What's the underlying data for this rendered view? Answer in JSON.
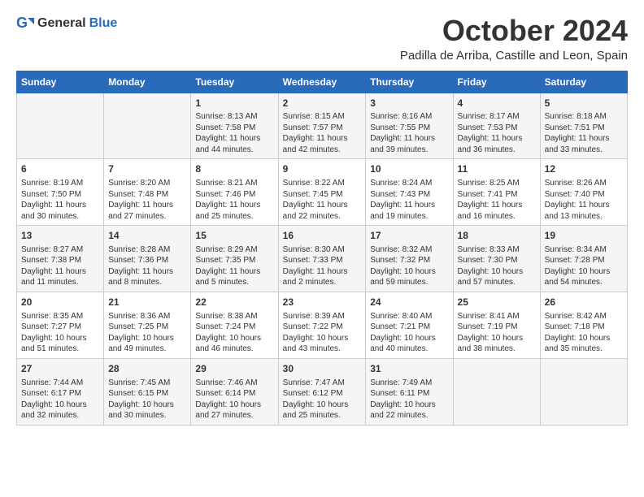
{
  "header": {
    "logo": {
      "text_general": "General",
      "text_blue": "Blue"
    },
    "title": "October 2024",
    "subtitle": "Padilla de Arriba, Castille and Leon, Spain"
  },
  "calendar": {
    "days_of_week": [
      "Sunday",
      "Monday",
      "Tuesday",
      "Wednesday",
      "Thursday",
      "Friday",
      "Saturday"
    ],
    "weeks": [
      [
        {
          "day": "",
          "info": ""
        },
        {
          "day": "",
          "info": ""
        },
        {
          "day": "1",
          "info": "Sunrise: 8:13 AM\nSunset: 7:58 PM\nDaylight: 11 hours and 44 minutes."
        },
        {
          "day": "2",
          "info": "Sunrise: 8:15 AM\nSunset: 7:57 PM\nDaylight: 11 hours and 42 minutes."
        },
        {
          "day": "3",
          "info": "Sunrise: 8:16 AM\nSunset: 7:55 PM\nDaylight: 11 hours and 39 minutes."
        },
        {
          "day": "4",
          "info": "Sunrise: 8:17 AM\nSunset: 7:53 PM\nDaylight: 11 hours and 36 minutes."
        },
        {
          "day": "5",
          "info": "Sunrise: 8:18 AM\nSunset: 7:51 PM\nDaylight: 11 hours and 33 minutes."
        }
      ],
      [
        {
          "day": "6",
          "info": "Sunrise: 8:19 AM\nSunset: 7:50 PM\nDaylight: 11 hours and 30 minutes."
        },
        {
          "day": "7",
          "info": "Sunrise: 8:20 AM\nSunset: 7:48 PM\nDaylight: 11 hours and 27 minutes."
        },
        {
          "day": "8",
          "info": "Sunrise: 8:21 AM\nSunset: 7:46 PM\nDaylight: 11 hours and 25 minutes."
        },
        {
          "day": "9",
          "info": "Sunrise: 8:22 AM\nSunset: 7:45 PM\nDaylight: 11 hours and 22 minutes."
        },
        {
          "day": "10",
          "info": "Sunrise: 8:24 AM\nSunset: 7:43 PM\nDaylight: 11 hours and 19 minutes."
        },
        {
          "day": "11",
          "info": "Sunrise: 8:25 AM\nSunset: 7:41 PM\nDaylight: 11 hours and 16 minutes."
        },
        {
          "day": "12",
          "info": "Sunrise: 8:26 AM\nSunset: 7:40 PM\nDaylight: 11 hours and 13 minutes."
        }
      ],
      [
        {
          "day": "13",
          "info": "Sunrise: 8:27 AM\nSunset: 7:38 PM\nDaylight: 11 hours and 11 minutes."
        },
        {
          "day": "14",
          "info": "Sunrise: 8:28 AM\nSunset: 7:36 PM\nDaylight: 11 hours and 8 minutes."
        },
        {
          "day": "15",
          "info": "Sunrise: 8:29 AM\nSunset: 7:35 PM\nDaylight: 11 hours and 5 minutes."
        },
        {
          "day": "16",
          "info": "Sunrise: 8:30 AM\nSunset: 7:33 PM\nDaylight: 11 hours and 2 minutes."
        },
        {
          "day": "17",
          "info": "Sunrise: 8:32 AM\nSunset: 7:32 PM\nDaylight: 10 hours and 59 minutes."
        },
        {
          "day": "18",
          "info": "Sunrise: 8:33 AM\nSunset: 7:30 PM\nDaylight: 10 hours and 57 minutes."
        },
        {
          "day": "19",
          "info": "Sunrise: 8:34 AM\nSunset: 7:28 PM\nDaylight: 10 hours and 54 minutes."
        }
      ],
      [
        {
          "day": "20",
          "info": "Sunrise: 8:35 AM\nSunset: 7:27 PM\nDaylight: 10 hours and 51 minutes."
        },
        {
          "day": "21",
          "info": "Sunrise: 8:36 AM\nSunset: 7:25 PM\nDaylight: 10 hours and 49 minutes."
        },
        {
          "day": "22",
          "info": "Sunrise: 8:38 AM\nSunset: 7:24 PM\nDaylight: 10 hours and 46 minutes."
        },
        {
          "day": "23",
          "info": "Sunrise: 8:39 AM\nSunset: 7:22 PM\nDaylight: 10 hours and 43 minutes."
        },
        {
          "day": "24",
          "info": "Sunrise: 8:40 AM\nSunset: 7:21 PM\nDaylight: 10 hours and 40 minutes."
        },
        {
          "day": "25",
          "info": "Sunrise: 8:41 AM\nSunset: 7:19 PM\nDaylight: 10 hours and 38 minutes."
        },
        {
          "day": "26",
          "info": "Sunrise: 8:42 AM\nSunset: 7:18 PM\nDaylight: 10 hours and 35 minutes."
        }
      ],
      [
        {
          "day": "27",
          "info": "Sunrise: 7:44 AM\nSunset: 6:17 PM\nDaylight: 10 hours and 32 minutes."
        },
        {
          "day": "28",
          "info": "Sunrise: 7:45 AM\nSunset: 6:15 PM\nDaylight: 10 hours and 30 minutes."
        },
        {
          "day": "29",
          "info": "Sunrise: 7:46 AM\nSunset: 6:14 PM\nDaylight: 10 hours and 27 minutes."
        },
        {
          "day": "30",
          "info": "Sunrise: 7:47 AM\nSunset: 6:12 PM\nDaylight: 10 hours and 25 minutes."
        },
        {
          "day": "31",
          "info": "Sunrise: 7:49 AM\nSunset: 6:11 PM\nDaylight: 10 hours and 22 minutes."
        },
        {
          "day": "",
          "info": ""
        },
        {
          "day": "",
          "info": ""
        }
      ]
    ]
  }
}
